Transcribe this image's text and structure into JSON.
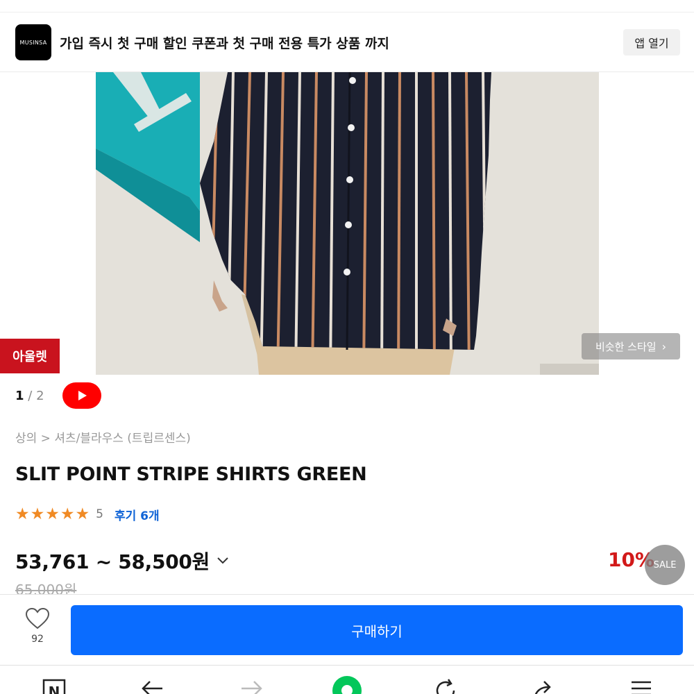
{
  "banner": {
    "logo_text": "MUSINSA",
    "promo_text": "가입 즉시 첫 구매 할인 쿠폰과 첫 구매 전용 특가 상품 까지",
    "app_open_label": "앱 열기"
  },
  "hero": {
    "outlet_label": "아울렛",
    "similar_style_label": "비슷한 스타일",
    "page_current": "1",
    "page_separator": "/",
    "page_total": "2"
  },
  "product": {
    "breadcrumb": "상의 > 셔츠/블라우스 (트립르센스)",
    "title": "SLIT POINT STRIPE SHIRTS GREEN",
    "stars": "★★★★★",
    "rating": "5",
    "reviews_label": "후기 6개",
    "price_range": "53,761 ~ 58,500원",
    "original_price": "65,000원",
    "discount": "10%",
    "sale_label": "SALE"
  },
  "buy_bar": {
    "like_count": "92",
    "purchase_label": "구매하기"
  },
  "colors": {
    "outlet_red": "#c9131e",
    "youtube_red": "#ff0000",
    "star_orange": "#f08a24",
    "link_blue": "#0f63d6",
    "discount_red": "#d21919",
    "purchase_blue": "#0a6cff",
    "nav_green": "#03c75a"
  },
  "bottom_nav": {
    "icons": [
      "naver-n-icon",
      "back-arrow-icon",
      "forward-arrow-icon",
      "green-dot-icon",
      "refresh-icon",
      "share-icon",
      "menu-icon"
    ]
  }
}
